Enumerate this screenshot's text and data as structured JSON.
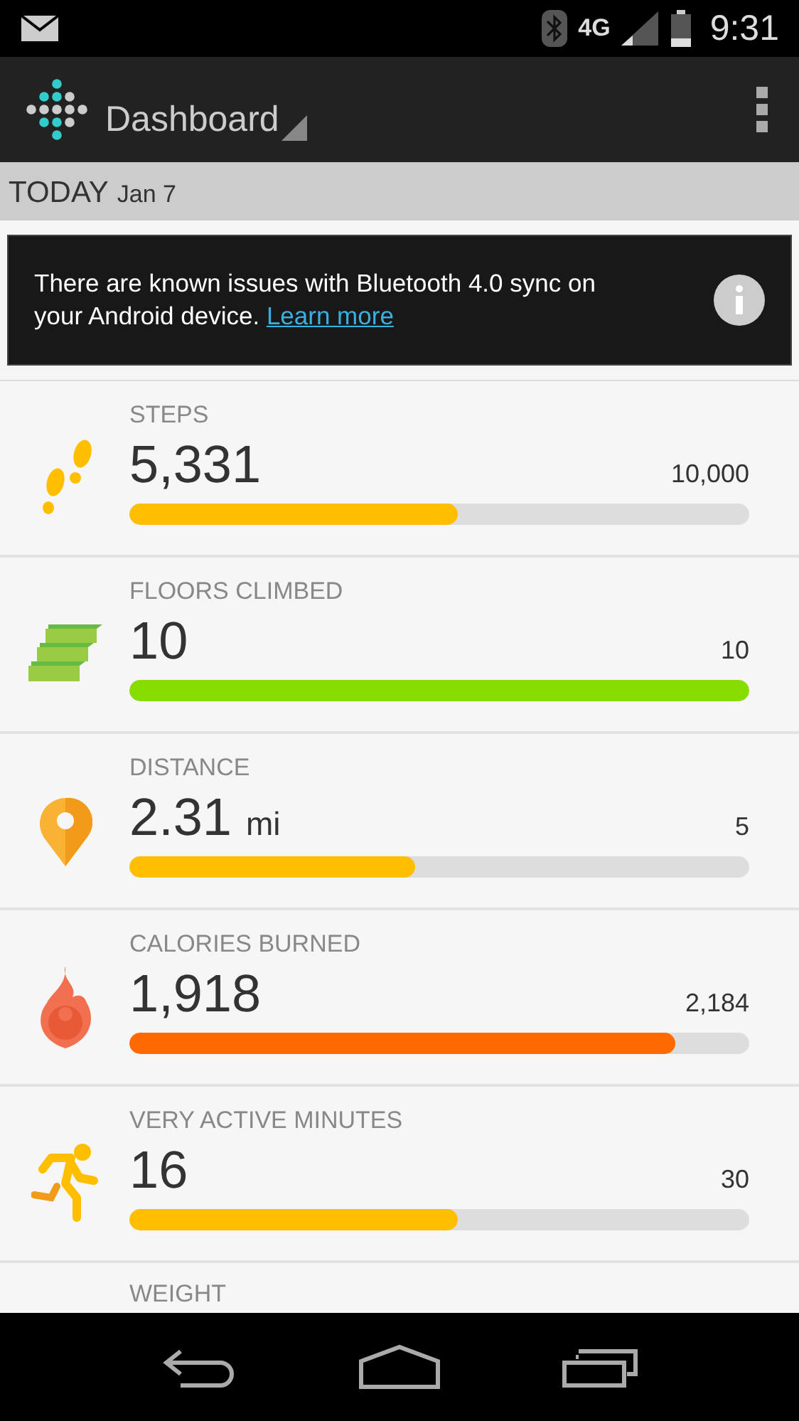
{
  "status_bar": {
    "network": "4G",
    "time": "9:31"
  },
  "toolbar": {
    "title": "Dashboard"
  },
  "date_header": {
    "label": "TODAY",
    "date": "Jan 7"
  },
  "banner": {
    "message": "There are known issues with Bluetooth 4.0 sync on your Android device.",
    "link": "Learn more"
  },
  "metrics": [
    {
      "kind": "steps",
      "label": "STEPS",
      "value": "5,331",
      "goal": "10,000",
      "level": 0.53,
      "color": "#ffbf00"
    },
    {
      "kind": "floors",
      "label": "FLOORS CLIMBED",
      "value": "10",
      "goal": "10",
      "level": 1,
      "color": "#88dd00"
    },
    {
      "kind": "distance",
      "label": "DISTANCE",
      "value": "2.31",
      "unit": "mi",
      "goal": "5",
      "level": 0.46,
      "color": "#ffbf00"
    },
    {
      "kind": "calories",
      "label": "CALORIES BURNED",
      "value": "1,918",
      "goal": "2,184",
      "level": 0.88,
      "color": "#ff6a00"
    },
    {
      "kind": "active",
      "label": "VERY ACTIVE MINUTES",
      "value": "16",
      "goal": "30",
      "level": 0.53,
      "color": "#ffbf00"
    },
    {
      "kind": "weight",
      "label": "WEIGHT"
    }
  ]
}
